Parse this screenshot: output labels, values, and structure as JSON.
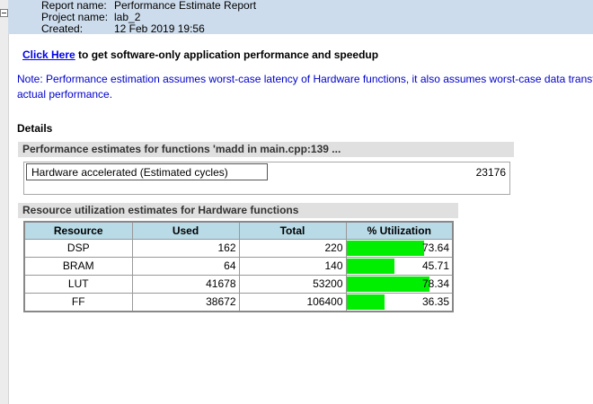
{
  "header": {
    "rows": [
      {
        "label": "Report name:",
        "value": "Performance Estimate Report"
      },
      {
        "label": "Project name:",
        "value": "lab_2"
      },
      {
        "label": "Created:",
        "value": "12 Feb 2019 19:56"
      }
    ]
  },
  "cta": {
    "link_text": "Click Here",
    "rest_text": " to get software-only application performance and speedup"
  },
  "note": {
    "line1": "Note: Performance estimation assumes worst-case latency of Hardware functions, it also assumes worst-case data transfer",
    "line2": "actual performance."
  },
  "details": {
    "heading": "Details",
    "perf_section_title": "Performance estimates for functions 'madd in main.cpp:139 ...",
    "perf_label": "Hardware accelerated (Estimated cycles)",
    "perf_value": "23176",
    "resource_section_title": "Resource utilization estimates for Hardware functions",
    "table": {
      "headers": [
        "Resource",
        "Used",
        "Total",
        "% Utilization"
      ],
      "rows": [
        {
          "resource": "DSP",
          "used": "162",
          "total": "220",
          "util": "73.64",
          "util_fraction": 0.7364
        },
        {
          "resource": "BRAM",
          "used": "64",
          "total": "140",
          "util": "45.71",
          "util_fraction": 0.4571
        },
        {
          "resource": "LUT",
          "used": "41678",
          "total": "53200",
          "util": "78.34",
          "util_fraction": 0.7834
        },
        {
          "resource": "FF",
          "used": "38672",
          "total": "106400",
          "util": "36.35",
          "util_fraction": 0.3635
        }
      ]
    }
  },
  "colors": {
    "header_bg": "#cddcec",
    "link": "#0000ee",
    "note_text": "#0000cc",
    "table_header_bg": "#b8dbe7",
    "util_bar": "#00ee00"
  }
}
